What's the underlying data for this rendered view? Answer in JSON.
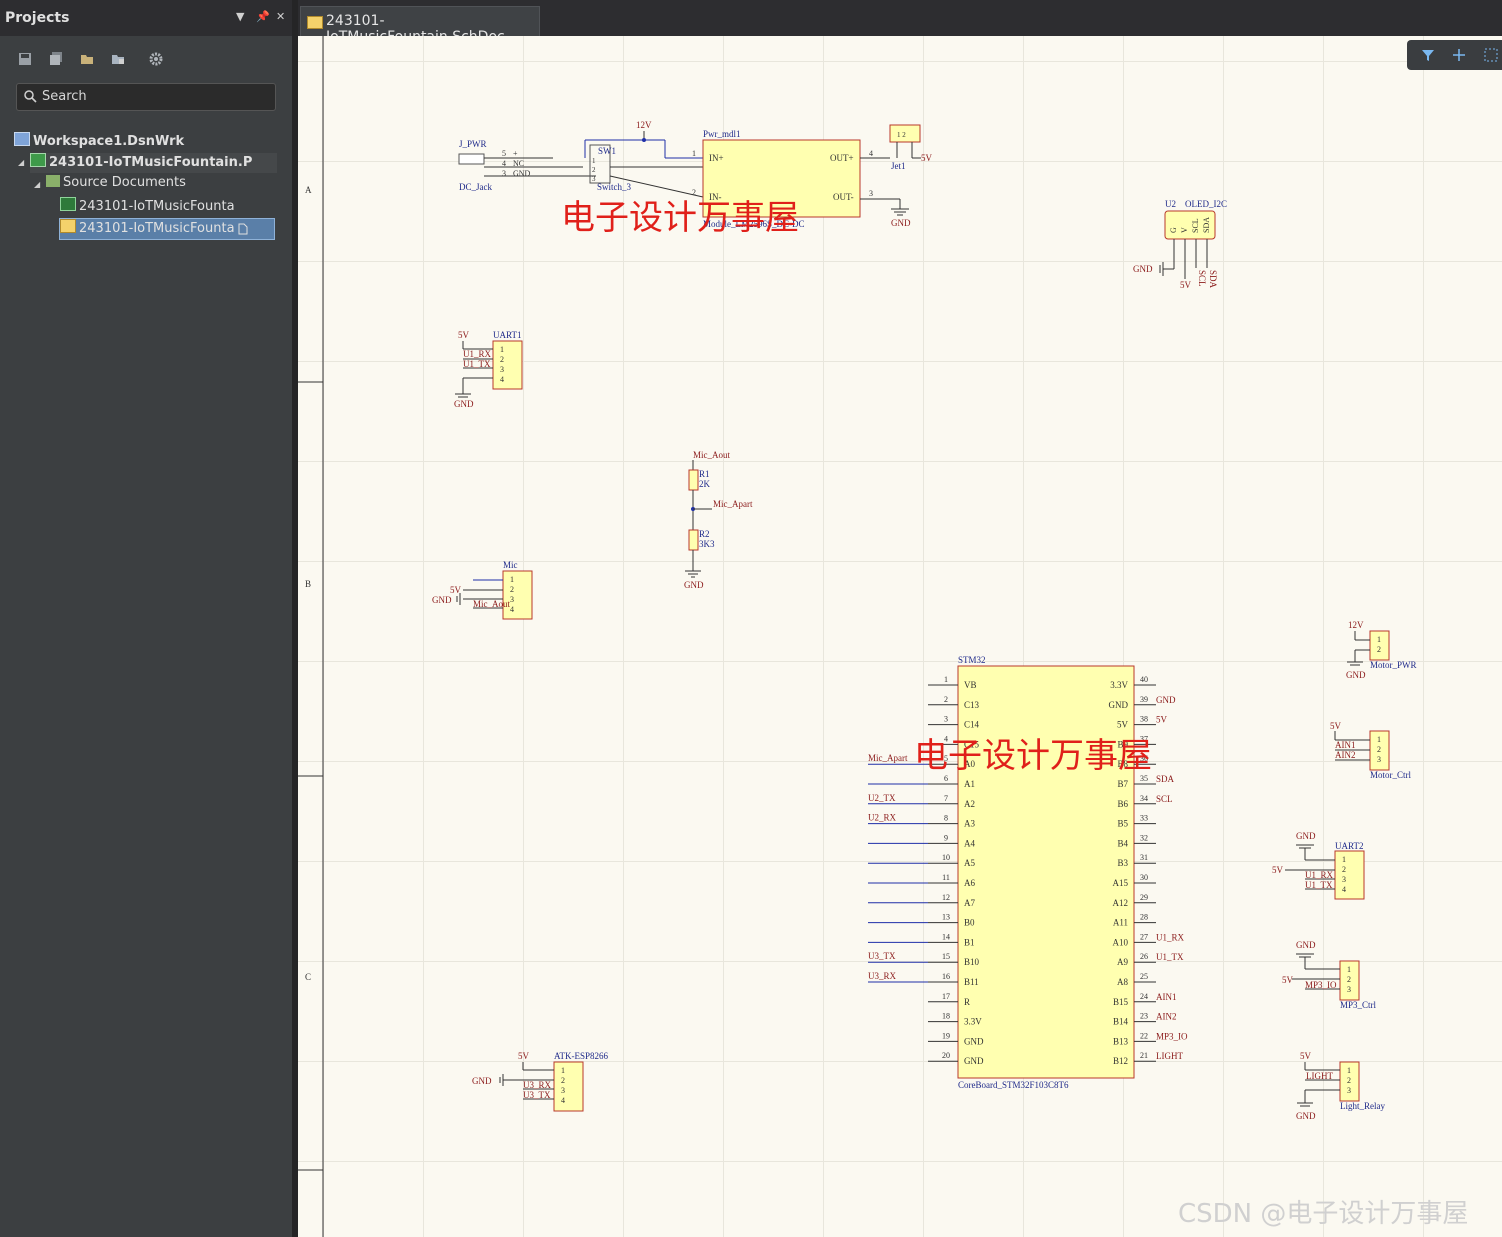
{
  "panel": {
    "title": "Projects",
    "search_placeholder": "Search",
    "toolbar_icons": [
      "save-icon",
      "save-all-icon",
      "open-folder-icon",
      "add-folder-icon",
      "gear-icon"
    ],
    "header_icons": [
      "dropdown-icon",
      "pin-icon",
      "close-icon"
    ],
    "tree": {
      "workspace": "Workspace1.DsnWrk",
      "project": "243101-IoTMusicFountain.P",
      "folder": "Source Documents",
      "docs": [
        "243101-IoTMusicFounta",
        "243101-IoTMusicFounta"
      ]
    }
  },
  "tab": {
    "label": "243101-IoTMusicFountain.SchDoc"
  },
  "active_bar": [
    "filter-icon",
    "plus-icon",
    "select-icon"
  ],
  "sheet": {
    "zones": [
      "A",
      "B",
      "C"
    ],
    "power": {
      "jack_ref": "J_PWR",
      "jack_part": "DC_Jack",
      "jack_pins": [
        {
          "n": "5",
          "name": "+"
        },
        {
          "n": "4",
          "name": "NC"
        },
        {
          "n": "3",
          "name": "GND"
        }
      ],
      "net_12v": "12V",
      "sw_ref": "SW1",
      "sw_part": "Switch_3",
      "sw_pins": [
        "1",
        "2",
        "3"
      ],
      "module_ref": "Pwr_mdl1",
      "module_part": "Module_LM2596S_DC-DC",
      "module_pins": {
        "in_p": "IN+",
        "in_n": "IN-",
        "out_p": "OUT+",
        "out_n": "OUT-",
        "p1": "1",
        "p2": "2",
        "p3": "3",
        "p4": "4"
      },
      "jet_ref": "Jet1",
      "jet_pins": "1 2",
      "net_5v": "5V",
      "gnd": "GND"
    },
    "oled": {
      "ref": "U2",
      "part": "OLED_I2C",
      "pins": [
        "G",
        "V",
        "SCL",
        "SDA"
      ],
      "nets": [
        "GND",
        "5V",
        "SCL",
        "SDA"
      ]
    },
    "uart1": {
      "ref": "UART1",
      "net_top": "5V",
      "nets": [
        "U1_RX",
        "U1_TX"
      ],
      "pins": [
        "1",
        "2",
        "3",
        "4"
      ],
      "gnd": "GND"
    },
    "divider": {
      "top": "Mic_Aout",
      "r1_ref": "R1",
      "r1_val": "2K",
      "mid": "Mic_Apart",
      "r2_ref": "R2",
      "r2_val": "3K3",
      "gnd": "GND"
    },
    "mic": {
      "ref": "Mic",
      "pins": [
        "1",
        "2",
        "3",
        "4"
      ],
      "net_5v": "5V",
      "gnd": "GND",
      "net": "Mic_Aout"
    },
    "motor_pwr": {
      "net": "12V",
      "ref": "Motor_PWR",
      "pins": [
        "1",
        "2"
      ],
      "gnd": "GND"
    },
    "motor_ctrl": {
      "net": "5V",
      "ref": "Motor_Ctrl",
      "nets": [
        "AIN1",
        "AIN2"
      ],
      "pins": [
        "1",
        "2",
        "3"
      ]
    },
    "uart2": {
      "ref": "UART2",
      "gnd": "GND",
      "net_5v": "5V",
      "nets": [
        "U1_RX",
        "U1_TX"
      ],
      "pins": [
        "1",
        "2",
        "3",
        "4"
      ]
    },
    "mp3": {
      "ref": "MP3_Ctrl",
      "gnd": "GND",
      "net_5v": "5V",
      "net": "MP3_IO",
      "pins": [
        "1",
        "2",
        "3"
      ]
    },
    "light": {
      "ref": "Light_Relay",
      "net_5v": "5V",
      "net": "LIGHT",
      "gnd": "GND",
      "pins": [
        "1",
        "2",
        "3"
      ]
    },
    "esp": {
      "ref": "ATK-ESP8266",
      "net_5v": "5V",
      "gnd": "GND",
      "nets": [
        "U3_RX",
        "U3_TX"
      ],
      "pins": [
        "1",
        "2",
        "3",
        "4"
      ]
    },
    "stm32": {
      "ref": "STM32",
      "part": "CoreBoard_STM32F103C8T6",
      "left": [
        {
          "n": "1",
          "name": "VB",
          "net": ""
        },
        {
          "n": "2",
          "name": "C13",
          "net": ""
        },
        {
          "n": "3",
          "name": "C14",
          "net": ""
        },
        {
          "n": "4",
          "name": "C15",
          "net": ""
        },
        {
          "n": "5",
          "name": "A0",
          "net": "Mic_Apart"
        },
        {
          "n": "6",
          "name": "A1",
          "net": ""
        },
        {
          "n": "7",
          "name": "A2",
          "net": "U2_TX"
        },
        {
          "n": "8",
          "name": "A3",
          "net": "U2_RX"
        },
        {
          "n": "9",
          "name": "A4",
          "net": ""
        },
        {
          "n": "10",
          "name": "A5",
          "net": ""
        },
        {
          "n": "11",
          "name": "A6",
          "net": ""
        },
        {
          "n": "12",
          "name": "A7",
          "net": ""
        },
        {
          "n": "13",
          "name": "B0",
          "net": ""
        },
        {
          "n": "14",
          "name": "B1",
          "net": ""
        },
        {
          "n": "15",
          "name": "B10",
          "net": "U3_TX"
        },
        {
          "n": "16",
          "name": "B11",
          "net": "U3_RX"
        },
        {
          "n": "17",
          "name": "R",
          "net": ""
        },
        {
          "n": "18",
          "name": "3.3V",
          "net": ""
        },
        {
          "n": "19",
          "name": "GND",
          "net": ""
        },
        {
          "n": "20",
          "name": "GND",
          "net": ""
        }
      ],
      "right": [
        {
          "n": "40",
          "name": "3.3V",
          "net": ""
        },
        {
          "n": "39",
          "name": "GND",
          "net": "GND"
        },
        {
          "n": "38",
          "name": "5V",
          "net": "5V"
        },
        {
          "n": "37",
          "name": "B9",
          "net": ""
        },
        {
          "n": "36",
          "name": "B8",
          "net": ""
        },
        {
          "n": "35",
          "name": "B7",
          "net": "SDA"
        },
        {
          "n": "34",
          "name": "B6",
          "net": "SCL"
        },
        {
          "n": "33",
          "name": "B5",
          "net": ""
        },
        {
          "n": "32",
          "name": "B4",
          "net": ""
        },
        {
          "n": "31",
          "name": "B3",
          "net": ""
        },
        {
          "n": "30",
          "name": "A15",
          "net": ""
        },
        {
          "n": "29",
          "name": "A12",
          "net": ""
        },
        {
          "n": "28",
          "name": "A11",
          "net": ""
        },
        {
          "n": "27",
          "name": "A10",
          "net": "U1_RX"
        },
        {
          "n": "26",
          "name": "A9",
          "net": "U1_TX"
        },
        {
          "n": "25",
          "name": "A8",
          "net": ""
        },
        {
          "n": "24",
          "name": "B15",
          "net": "AIN1"
        },
        {
          "n": "23",
          "name": "B14",
          "net": "AIN2"
        },
        {
          "n": "22",
          "name": "B13",
          "net": "MP3_IO"
        },
        {
          "n": "21",
          "name": "B12",
          "net": "LIGHT"
        }
      ]
    },
    "watermark": "电子设计万事屋",
    "credit": "CSDN @电子设计万事屋"
  },
  "colors": {
    "wire": "#1f2fa8",
    "pin": "#3a1f1f",
    "part_fill": "#ffffb0",
    "part_border": "#b8382a",
    "net_label": "#8b1a1a",
    "text_blue": "#1f2a8a"
  }
}
